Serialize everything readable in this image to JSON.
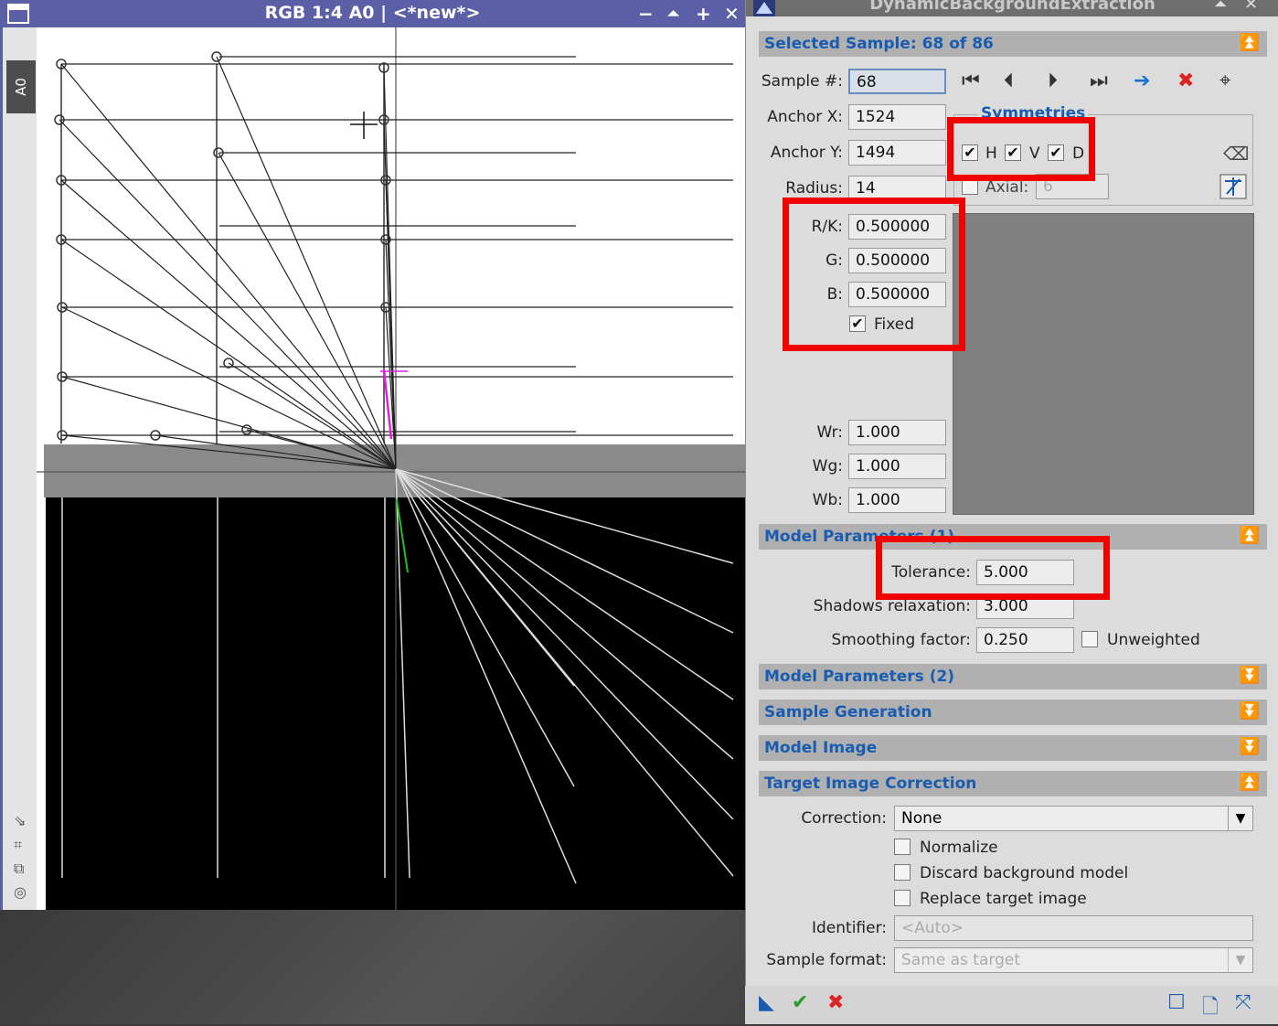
{
  "image_window": {
    "title": "RGB 1:4 A0 | <*new*>",
    "tab": "A0",
    "buttons": [
      "−",
      "⏶",
      "+",
      "✕"
    ]
  },
  "panel": {
    "title": "DynamicBackgroundExtraction",
    "selected_sample": {
      "header": "Selected Sample: 68 of 86",
      "sample_label": "Sample #:",
      "sample_value": "68",
      "anchor_x_label": "Anchor X:",
      "anchor_x": "1524",
      "anchor_y_label": "Anchor Y:",
      "anchor_y": "1494",
      "radius_label": "Radius:",
      "radius": "14",
      "rk_label": "R/K:",
      "rk": "0.500000",
      "g_label": "G:",
      "g": "0.500000",
      "b_label": "B:",
      "b": "0.500000",
      "fixed_label": "Fixed",
      "wr_label": "Wr:",
      "wr": "1.000",
      "wg_label": "Wg:",
      "wg": "1.000",
      "wb_label": "Wb:",
      "wb": "1.000",
      "symmetries_label": "Symmetries",
      "h_label": "H",
      "v_label": "V",
      "d_label": "D",
      "axial_label": "Axial:",
      "axial_value": "6"
    },
    "model_params1": {
      "header": "Model Parameters (1)",
      "tolerance_label": "Tolerance:",
      "tolerance": "5.000",
      "shadows_label": "Shadows relaxation:",
      "shadows": "3.000",
      "smoothing_label": "Smoothing factor:",
      "smoothing": "0.250",
      "unweighted_label": "Unweighted"
    },
    "model_params2": {
      "header": "Model Parameters (2)"
    },
    "sample_generation": {
      "header": "Sample Generation"
    },
    "model_image": {
      "header": "Model Image"
    },
    "target_correction": {
      "header": "Target Image Correction",
      "correction_label": "Correction:",
      "correction": "None",
      "normalize_label": "Normalize",
      "discard_label": "Discard background model",
      "replace_label": "Replace target image",
      "identifier_label": "Identifier:",
      "identifier_placeholder": "<Auto>",
      "format_label": "Sample format:",
      "format": "Same as target"
    }
  }
}
